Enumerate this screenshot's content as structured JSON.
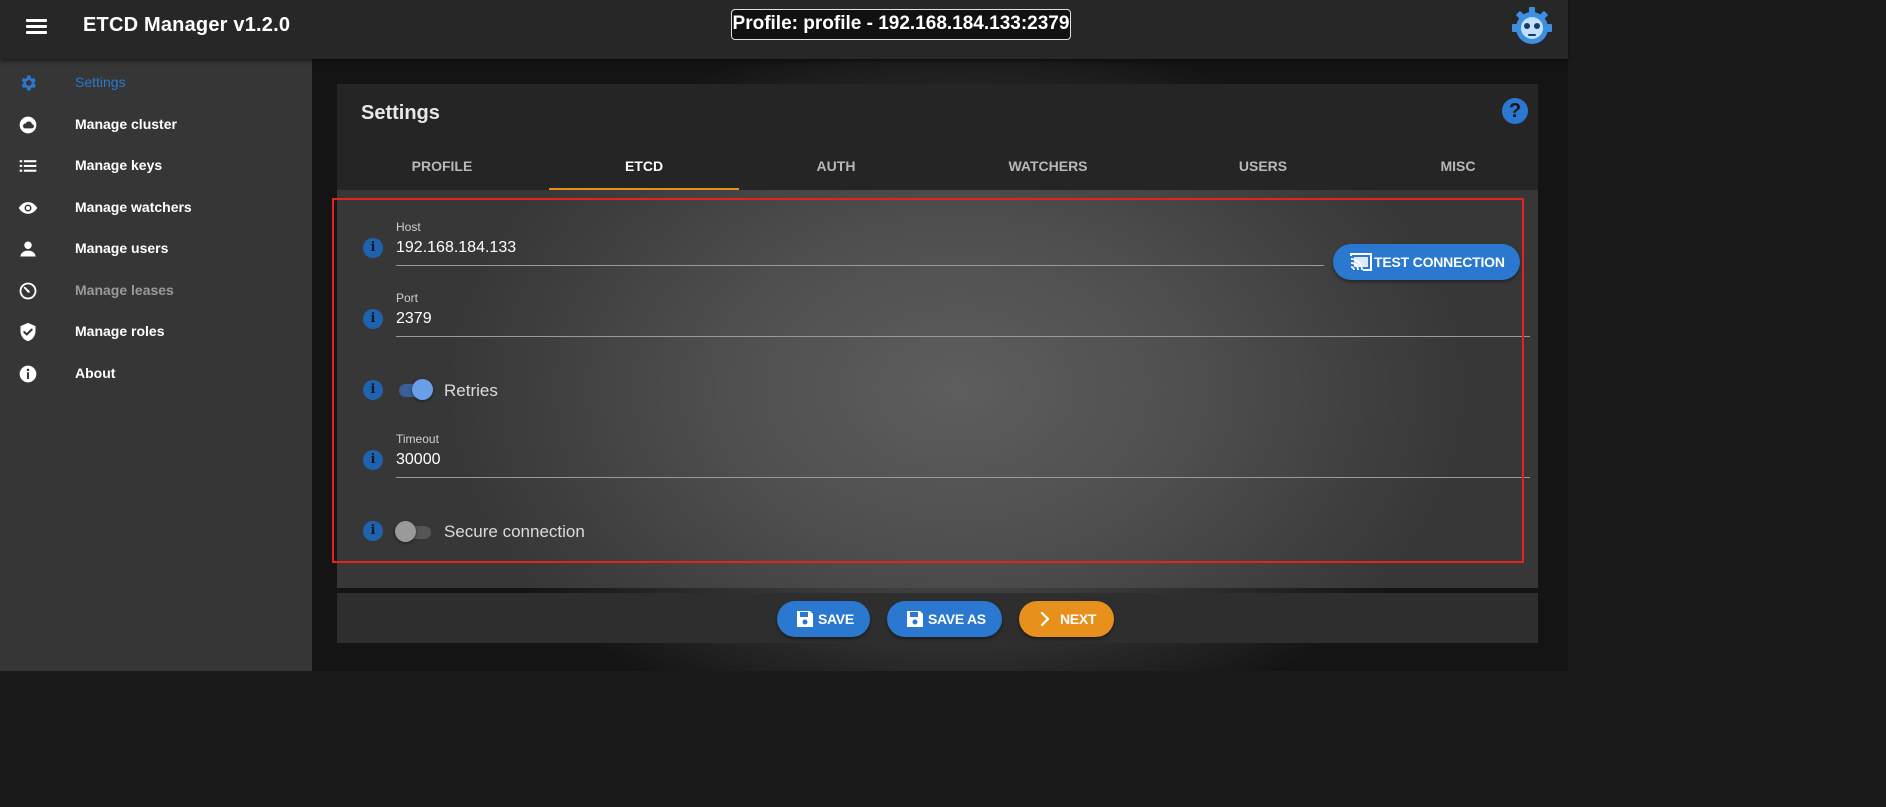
{
  "app": {
    "title": "ETCD Manager v1.2.0",
    "profile_chip": "Profile: profile - 192.168.184.133:2379",
    "menu_icon": "hamburger-menu-icon",
    "logo_icon": "etcd-robot-logo-icon"
  },
  "sidebar": {
    "items": [
      {
        "label": "Settings",
        "icon": "gear-icon",
        "state": "active"
      },
      {
        "label": "Manage cluster",
        "icon": "cloud-icon",
        "state": "normal"
      },
      {
        "label": "Manage keys",
        "icon": "list-icon",
        "state": "normal"
      },
      {
        "label": "Manage watchers",
        "icon": "eye-icon",
        "state": "normal"
      },
      {
        "label": "Manage users",
        "icon": "person-icon",
        "state": "normal"
      },
      {
        "label": "Manage leases",
        "icon": "timer-icon",
        "state": "disabled"
      },
      {
        "label": "Manage roles",
        "icon": "shield-check-icon",
        "state": "normal"
      },
      {
        "label": "About",
        "icon": "info-icon",
        "state": "normal"
      }
    ]
  },
  "settings": {
    "title": "Settings",
    "help_icon": "help-icon",
    "tabs": [
      "PROFILE",
      "ETCD",
      "AUTH",
      "WATCHERS",
      "USERS",
      "MISC"
    ],
    "active_tab": "ETCD"
  },
  "form": {
    "host": {
      "label": "Host",
      "value": "192.168.184.133"
    },
    "port": {
      "label": "Port",
      "value": "2379"
    },
    "retries": {
      "label": "Retries",
      "enabled": true
    },
    "timeout": {
      "label": "Timeout",
      "value": "30000"
    },
    "secure": {
      "label": "Secure connection",
      "enabled": false
    },
    "test_connection_label": "TEST CONNECTION"
  },
  "actions": {
    "save_label": "SAVE",
    "save_as_label": "SAVE AS",
    "next_label": "NEXT"
  },
  "colors": {
    "accent_blue": "#2a78cf",
    "accent_orange": "#e8901c",
    "highlight_red": "#e52222",
    "appbar": "#272727",
    "sidebar": "#363636"
  }
}
